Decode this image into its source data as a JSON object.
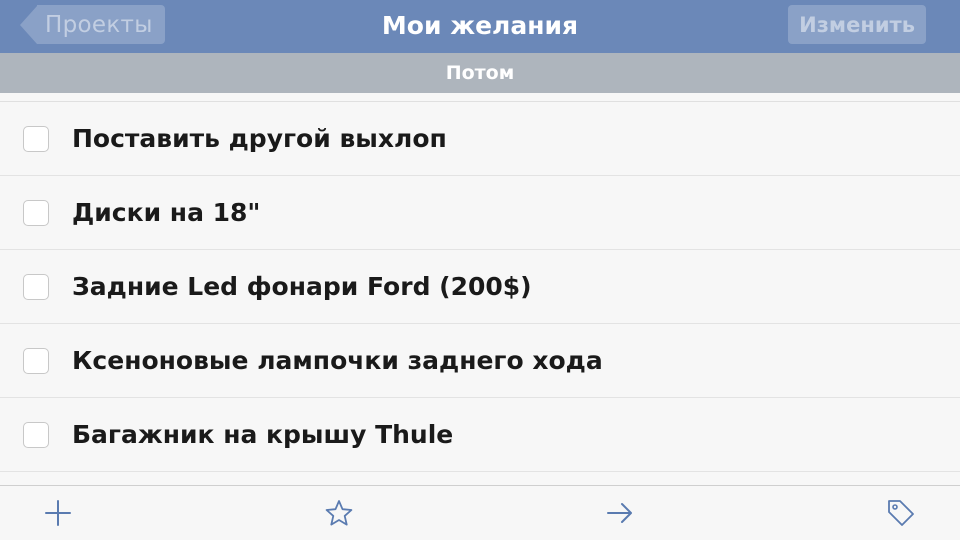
{
  "navbar": {
    "back_label": "Проекты",
    "title": "Мои желания",
    "edit_label": "Изменить"
  },
  "section": {
    "header": "Потом"
  },
  "items": [
    {
      "label": "Поставить другой выхлоп",
      "checked": false
    },
    {
      "label": "Диски на 18\"",
      "checked": false
    },
    {
      "label": "Задние Led фонари Ford (200$)",
      "checked": false
    },
    {
      "label": "Ксеноновые лампочки заднего хода",
      "checked": false
    },
    {
      "label": "Багажник на крышу Thule",
      "checked": false
    }
  ],
  "toolbar": {
    "icons": [
      "plus-icon",
      "star-icon",
      "arrow-right-icon",
      "tag-icon"
    ]
  },
  "colors": {
    "navbar": "#6b88b8",
    "section_header": "#aeb5bd",
    "accent_icon": "#5a7bb0"
  }
}
